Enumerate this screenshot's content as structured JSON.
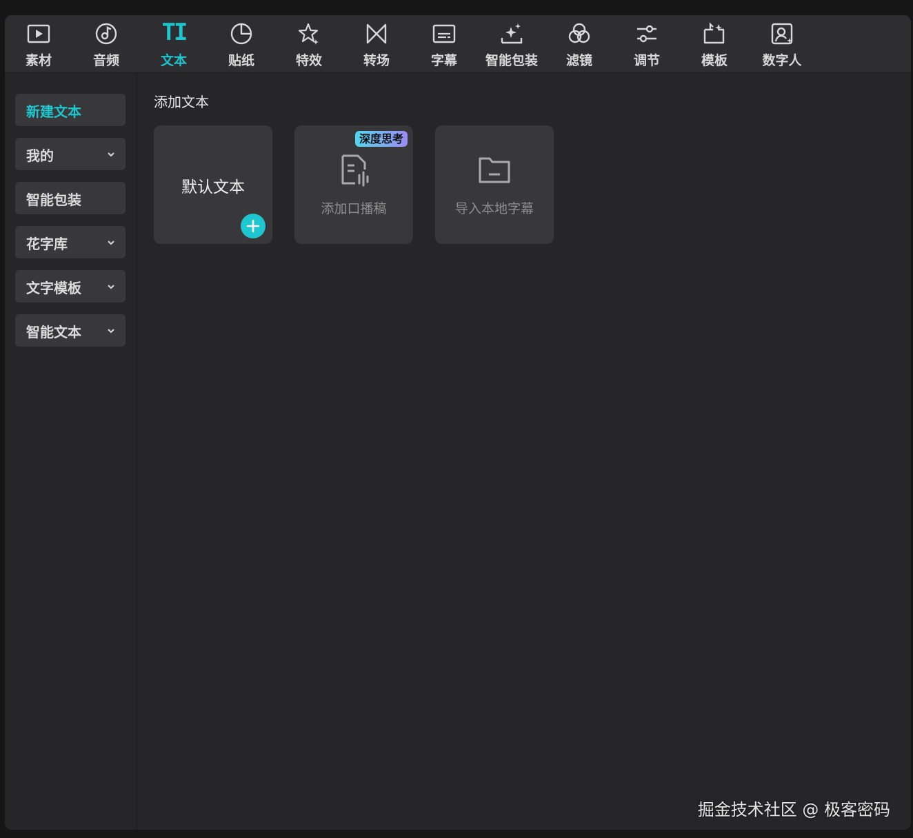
{
  "toolbar": {
    "tabs": [
      {
        "id": "media",
        "label": "素材",
        "icon": "media-play-icon"
      },
      {
        "id": "audio",
        "label": "音频",
        "icon": "music-note-icon"
      },
      {
        "id": "text",
        "label": "文本",
        "icon": "text-ti-icon",
        "icon_text": "TI",
        "active": true
      },
      {
        "id": "sticker",
        "label": "贴纸",
        "icon": "sticker-icon"
      },
      {
        "id": "effects",
        "label": "特效",
        "icon": "star-sparkle-icon"
      },
      {
        "id": "transition",
        "label": "转场",
        "icon": "bowtie-transition-icon"
      },
      {
        "id": "captions",
        "label": "字幕",
        "icon": "captions-icon"
      },
      {
        "id": "smart-pack",
        "label": "智能包装",
        "icon": "magic-wand-icon"
      },
      {
        "id": "filters",
        "label": "滤镜",
        "icon": "filter-circles-icon"
      },
      {
        "id": "adjust",
        "label": "调节",
        "icon": "sliders-icon"
      },
      {
        "id": "templates",
        "label": "模板",
        "icon": "template-icon"
      },
      {
        "id": "avatar",
        "label": "数字人",
        "icon": "digital-human-icon"
      }
    ]
  },
  "sidebar": {
    "items": [
      {
        "label": "新建文本",
        "active": true,
        "has_chevron": false
      },
      {
        "label": "我的",
        "active": false,
        "has_chevron": true
      },
      {
        "label": "智能包装",
        "active": false,
        "has_chevron": false
      },
      {
        "label": "花字库",
        "active": false,
        "has_chevron": true
      },
      {
        "label": "文字模板",
        "active": false,
        "has_chevron": true
      },
      {
        "label": "智能文本",
        "active": false,
        "has_chevron": true
      }
    ]
  },
  "main": {
    "section_title": "添加文本",
    "cards": [
      {
        "label": "默认文本",
        "icon": "plus-icon"
      },
      {
        "label": "添加口播稿",
        "icon": "script-document-icon",
        "badge": "深度思考"
      },
      {
        "label": "导入本地字幕",
        "icon": "folder-icon"
      }
    ]
  },
  "watermark": "掘金技术社区 @ 极客密码",
  "colors": {
    "accent": "#1fc6cf",
    "background": "#262628",
    "panel": "#38383a",
    "toolbar": "#2e2e30"
  }
}
